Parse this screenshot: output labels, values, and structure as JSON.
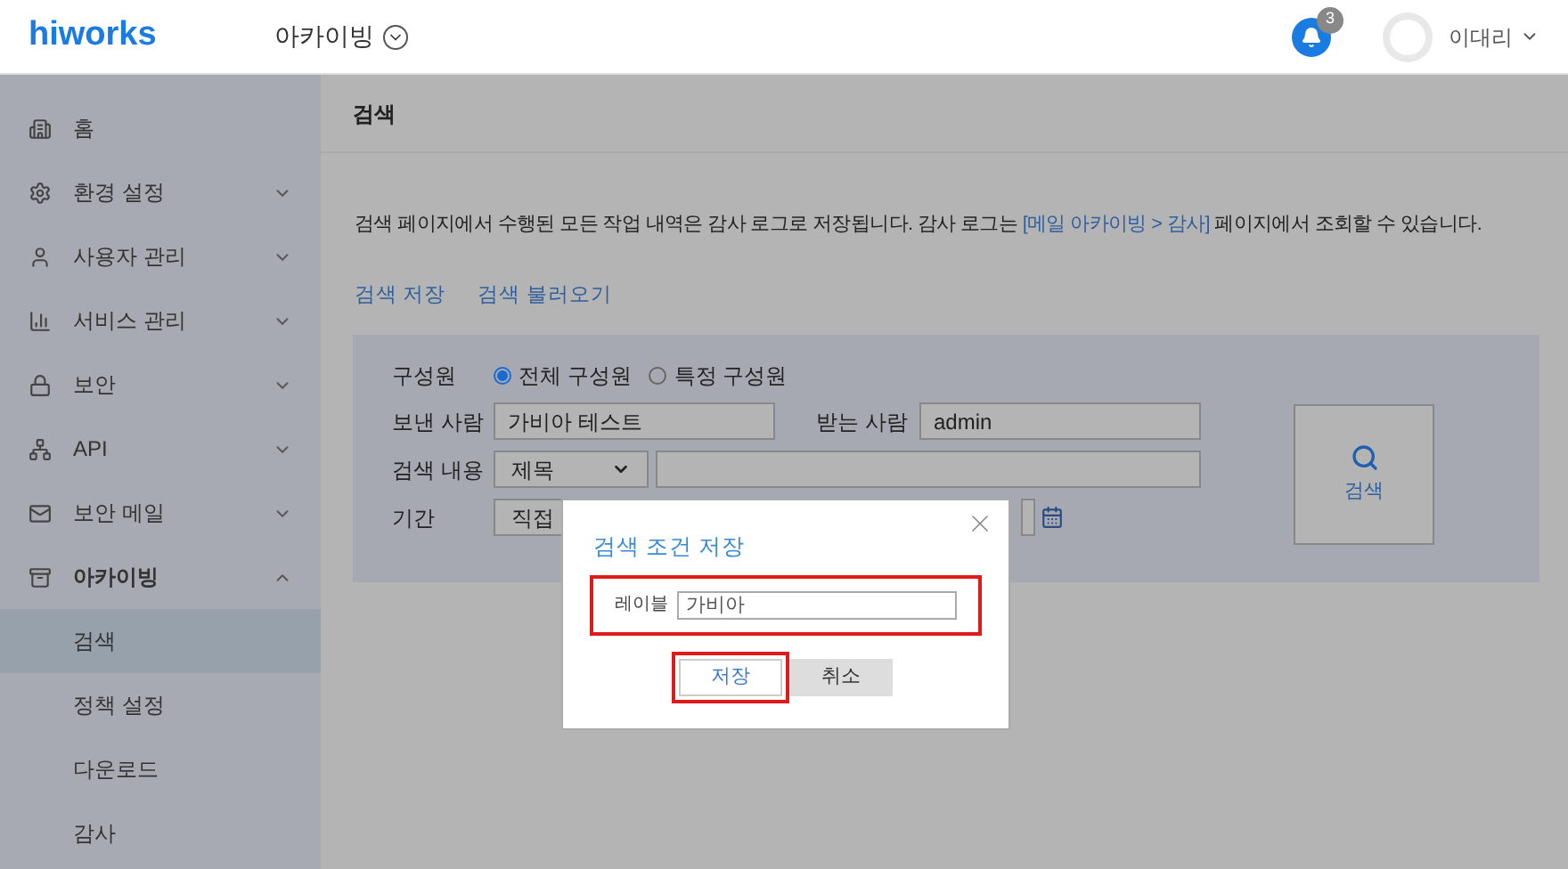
{
  "header": {
    "logo": "hiworks",
    "app_menu": "아카이빙",
    "notifications": "3",
    "user": "이대리"
  },
  "sidebar": {
    "items": [
      {
        "label": "홈",
        "kind": "link",
        "expanded": false
      },
      {
        "label": "환경 설정",
        "kind": "group",
        "expanded": false
      },
      {
        "label": "사용자 관리",
        "kind": "group",
        "expanded": false
      },
      {
        "label": "서비스 관리",
        "kind": "group",
        "expanded": false
      },
      {
        "label": "보안",
        "kind": "group",
        "expanded": false
      },
      {
        "label": "API",
        "kind": "group",
        "expanded": false
      },
      {
        "label": "보안 메일",
        "kind": "group",
        "expanded": false
      },
      {
        "label": "아카이빙",
        "kind": "group",
        "expanded": true,
        "children": [
          {
            "label": "검색",
            "selected": true
          },
          {
            "label": "정책 설정",
            "selected": false
          },
          {
            "label": "다운로드",
            "selected": false
          },
          {
            "label": "감사",
            "selected": false
          }
        ]
      }
    ]
  },
  "page": {
    "title": "검색",
    "description_parts": [
      "검색 페이지에서 수행된 모든 작업 내역은 감사 로그로 저장됩니다. 감사 로그는 ",
      "[메일 아카이빙 > 감사]",
      " 페이지에서 조회할 수 있습니다."
    ],
    "links": [
      "검색 저장",
      "검색 불러오기"
    ]
  },
  "form": {
    "member_label": "구성원",
    "member_options": [
      {
        "label": "전체 구성원",
        "selected": true
      },
      {
        "label": "특정 구성원",
        "selected": false
      }
    ],
    "sender_label": "보낸 사람",
    "sender_value": "가비아 테스트",
    "recipient_label": "받는 사람",
    "recipient_value": "admin",
    "content_label": "검색 내용",
    "content_select": "제목",
    "period_label": "기간",
    "period_select": "직접",
    "search_button": "검색"
  },
  "dialog": {
    "title": "검색 조건 저장",
    "field_label": "레이블",
    "field_value": "가비아",
    "field_highlighted": true,
    "buttons": [
      {
        "label": "저장",
        "highlighted": true
      },
      {
        "label": "취소",
        "highlighted": false
      }
    ]
  }
}
